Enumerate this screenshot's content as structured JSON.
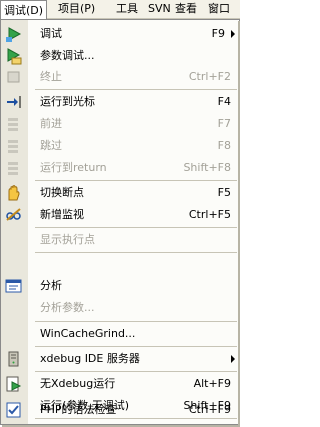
{
  "menubar": [
    {
      "label": "调试(D)"
    },
    {
      "label": "项目(P)"
    },
    {
      "label": "工具"
    },
    {
      "label": "SVN"
    },
    {
      "label": "查看"
    },
    {
      "label": "窗口"
    }
  ],
  "menu": {
    "items": [
      {
        "label": "调试",
        "shortcut": "F9",
        "icon": "debug-run-icon"
      },
      {
        "label": "参数调试...",
        "shortcut": "",
        "icon": "debug-params-icon"
      },
      {
        "label": "终止",
        "shortcut": "Ctrl+F2",
        "icon": "stop-icon"
      },
      {
        "label": "运行到光标",
        "shortcut": "F4",
        "icon": "run-to-cursor-icon"
      },
      {
        "label": "前进",
        "shortcut": "F7",
        "icon": "step-into-icon"
      },
      {
        "label": "跳过",
        "shortcut": "F8",
        "icon": "step-over-icon"
      },
      {
        "label": "运行到return",
        "shortcut": "Shift+F8",
        "icon": "run-to-return-icon"
      },
      {
        "label": "切换断点",
        "shortcut": "F5",
        "icon": "toggle-breakpoint-icon"
      },
      {
        "label": "新增监视",
        "shortcut": "Ctrl+F5",
        "icon": "add-watch-icon"
      },
      {
        "label": "显示执行点",
        "shortcut": "",
        "icon": ""
      },
      {
        "label": "分析",
        "shortcut": "",
        "icon": "profile-icon"
      },
      {
        "label": "分析参数...",
        "shortcut": "",
        "icon": ""
      },
      {
        "label": "WinCacheGrind...",
        "shortcut": "",
        "icon": ""
      },
      {
        "label": "xdebug IDE 服务器",
        "shortcut": "",
        "icon": "server-icon"
      },
      {
        "label": "无Xdebug运行",
        "shortcut": "Alt+F9",
        "icon": "run-without-debug-icon"
      },
      {
        "label": "运行(参数,无调试)",
        "shortcut": "Shift+F9",
        "icon": ""
      },
      {
        "label": "PHP的语法检查",
        "shortcut": "Ctrl+F9",
        "icon": "syntax-check-icon"
      }
    ]
  }
}
